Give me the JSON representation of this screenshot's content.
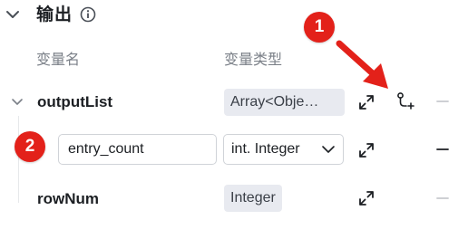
{
  "section": {
    "title": "输出",
    "chevron_icon": "chevron-down-icon",
    "info_icon": "info-icon"
  },
  "columns": {
    "name_header": "变量名",
    "type_header": "变量类型"
  },
  "rows": [
    {
      "name": "outputList",
      "type": "Array<Obje…",
      "expanded": true,
      "actions": [
        "expand-icon",
        "add-child-icon",
        "delete-icon"
      ],
      "delete_disabled": true
    },
    {
      "name_value": "entry_count",
      "type_selected": "int. Integer",
      "actions": [
        "expand-icon",
        "delete-icon"
      ],
      "delete_disabled": false
    },
    {
      "name": "rowNum",
      "type": "Integer",
      "actions": [
        "expand-icon",
        "delete-icon"
      ],
      "delete_disabled": true
    }
  ],
  "annotations": {
    "badge_1": "1",
    "badge_2": "2",
    "badge_color": "#e3211a"
  },
  "colors": {
    "tag_bg": "#e8eaf0",
    "muted_text": "#7b8088",
    "border": "#d0d3d8"
  }
}
